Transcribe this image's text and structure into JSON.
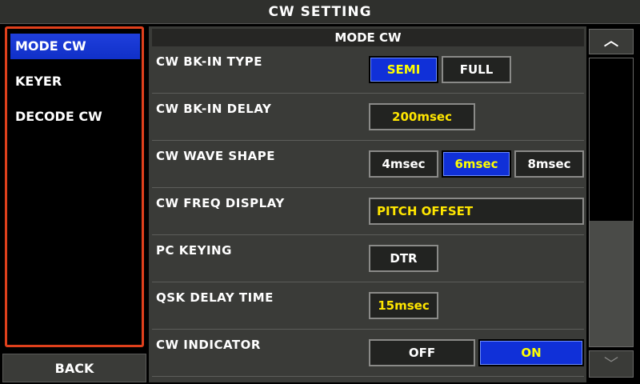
{
  "title": "CW SETTING",
  "menu": {
    "items": [
      {
        "label": "MODE CW",
        "selected": true
      },
      {
        "label": "KEYER",
        "selected": false
      },
      {
        "label": "DECODE CW",
        "selected": false
      }
    ],
    "back_label": "BACK"
  },
  "panel": {
    "header": "MODE CW",
    "rows": [
      {
        "label": "CW BK-IN TYPE",
        "options": [
          "SEMI",
          "FULL"
        ],
        "selected": "SEMI"
      },
      {
        "label": "CW BK-IN DELAY",
        "value": "200msec"
      },
      {
        "label": "CW WAVE SHAPE",
        "options": [
          "4msec",
          "6msec",
          "8msec"
        ],
        "selected": "6msec"
      },
      {
        "label": "CW FREQ DISPLAY",
        "value": "PITCH OFFSET"
      },
      {
        "label": "PC KEYING",
        "value": "DTR"
      },
      {
        "label": "QSK DELAY TIME",
        "value": "15msec"
      },
      {
        "label": "CW INDICATOR",
        "options": [
          "OFF",
          "ON"
        ],
        "selected": "ON"
      }
    ]
  },
  "scroll": {
    "up_icon": "chevron-up-icon",
    "down_icon": "chevron-down-icon",
    "up_glyph": "︿",
    "down_glyph": "﹀"
  },
  "colors": {
    "accent_blue": "#1030d8",
    "value_yellow": "#ffe600",
    "menu_border": "#e0401c"
  }
}
